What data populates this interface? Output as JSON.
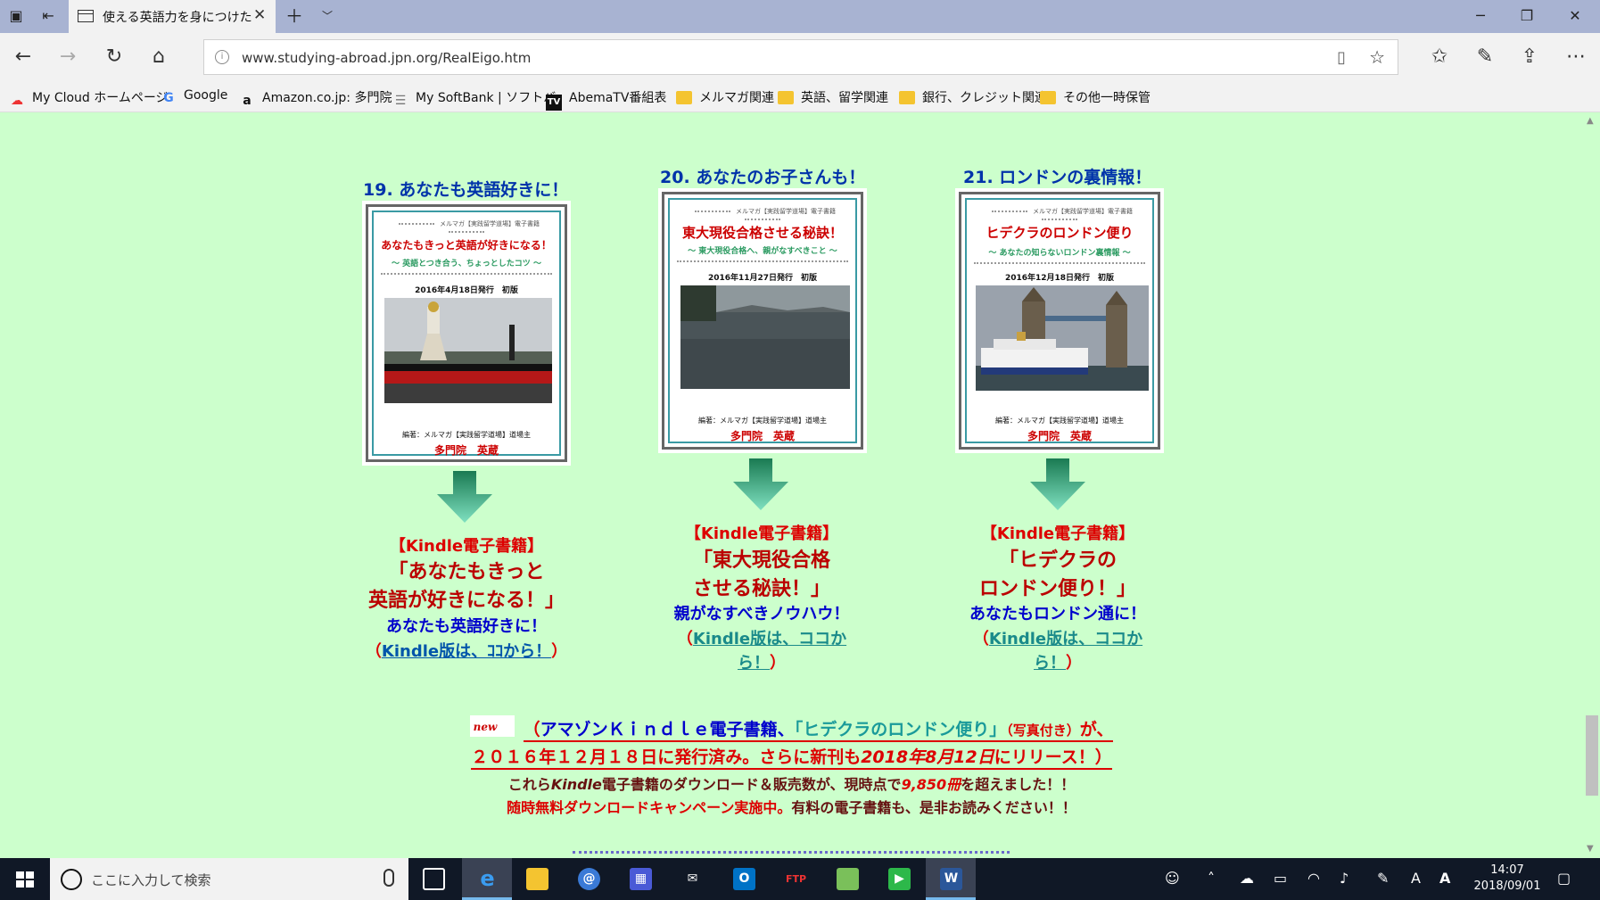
{
  "browser": {
    "tab_title": "使える英語力を身につけた",
    "url": "www.studying-abroad.jpn.org/RealEigo.htm",
    "favorites": [
      {
        "label": "My Cloud ホームページ",
        "icon": "cloud-icon"
      },
      {
        "label": "Google",
        "icon": "google-icon"
      },
      {
        "label": "Amazon.co.jp: 多門院",
        "icon": "amazon-icon"
      },
      {
        "label": "My SoftBank | ソフトバ",
        "icon": "softbank-icon"
      },
      {
        "label": "AbemaTV番組表",
        "icon": "abematv-icon"
      },
      {
        "label": "メルマガ関連",
        "icon": "folder-icon"
      },
      {
        "label": "英語、留学関連",
        "icon": "folder-icon"
      },
      {
        "label": "銀行、クレジット関連",
        "icon": "folder-icon"
      },
      {
        "label": "その他一時保管",
        "icon": "folder-icon"
      }
    ]
  },
  "books": [
    {
      "title": "19. あなたも英語好きに！",
      "cover": {
        "series": "メルマガ【実践留学道場】電子書籍",
        "title": "あなたもきっと英語が好きになる！",
        "subtitle": "～ 英語とつき合う、ちょっとしたコツ ～",
        "date": "2016年4月18日発行　初版",
        "editor": "編著：メルマガ【実践留学道場】道場主",
        "author": "多門院　英蔵"
      },
      "kindle_label": "【Kindle電子書籍】",
      "book_title_lines": [
        "「あなたもきっと",
        "英語が好きになる！」"
      ],
      "tagline": "あなたも英語好きに！",
      "link_open": "（",
      "link_lines": [
        "Kindle版は、ｺｺから！"
      ],
      "link_close": "）"
    },
    {
      "title": "20. あなたのお子さんも！",
      "cover": {
        "series": "メルマガ【実践留学道場】電子書籍",
        "title": "東大現役合格させる秘訣！",
        "subtitle": "～ 東大現役合格へ、親がなすべきこと ～",
        "date": "2016年11月27日発行　初版",
        "editor": "編著：メルマガ【実践留学道場】道場主",
        "author": "多門院　英蔵"
      },
      "kindle_label": "【Kindle電子書籍】",
      "book_title_lines": [
        "「東大現役合格",
        "させる秘訣！」"
      ],
      "tagline": "親がなすべきノウハウ！",
      "link_open": "（",
      "link_lines": [
        "Kindle版は、ココか",
        "ら！"
      ],
      "link_close": "）"
    },
    {
      "title": "21. ロンドンの裏情報！",
      "cover": {
        "series": "メルマガ【実践留学道場】電子書籍",
        "title": "ヒデクラのロンドン便り",
        "subtitle": "～ あなたの知らないロンドン裏情報 ～",
        "date": "2016年12月18日発行　初版",
        "editor": "編著：メルマガ【実践留学道場】道場主",
        "author": "多門院　英蔵"
      },
      "kindle_label": "【Kindle電子書籍】",
      "book_title_lines": [
        "「ヒデクラの",
        "ロンドン便り！」"
      ],
      "tagline": "あなたもロンドン通に！",
      "link_open": "（",
      "link_lines": [
        "Kindle版は、ココか",
        "ら！"
      ],
      "link_close": "）"
    }
  ],
  "announcement": {
    "new_badge": "new",
    "l1_open": "（",
    "l1_blue": "アマゾンＫｉｎｄｌｅ電子書籍、",
    "l1_teal": "「ヒデクラのロンドン便り」",
    "l1_small": "（写真付き）",
    "l1_end": "が、",
    "l2_a": "２０１６年１２月１８日に発行済み。さらに新刊も",
    "l2_italic": "2018年8月12日",
    "l2_b": "にリリース！）",
    "l3_a": "これら",
    "l3_italic": "Kindle",
    "l3_b": "電子書籍のダウンロード＆販売数が、現時点で",
    "l3_count": "9,850冊",
    "l3_c": "を超えました！！",
    "l4_red": "随時無料ダウンロードキャンペーン実施中。",
    "l4_dark": "有料の電子書籍も、是非お読みください！！"
  },
  "taskbar": {
    "search_placeholder": "ここに入力して検索",
    "time": "14:07",
    "date": "2018/09/01"
  },
  "colors": {
    "page_bg": "#ccffcc",
    "heading_blue": "#0033aa",
    "kindle_red": "#dd0000",
    "arrow_green": "#2a9a70"
  }
}
